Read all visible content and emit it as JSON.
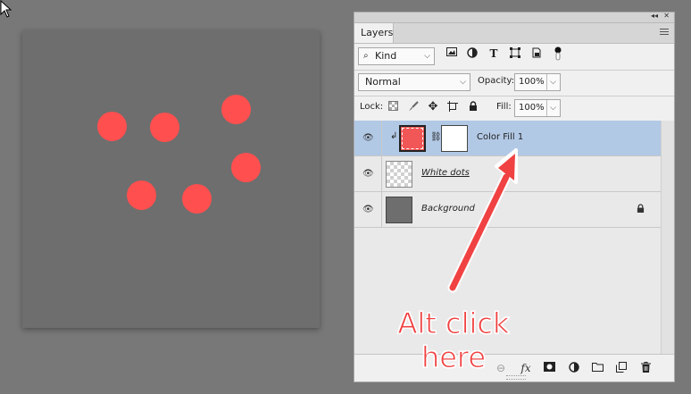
{
  "panel": {
    "title": "Layers",
    "collapse_glyph": "◂◂",
    "close_glyph": "✕"
  },
  "filter": {
    "kind_label": "Kind",
    "icons": [
      "image-filter-icon",
      "adjustment-filter-icon",
      "type-filter-icon",
      "shape-filter-icon",
      "smart-object-filter-icon",
      "filter-toggle-icon"
    ]
  },
  "blend": {
    "mode": "Normal",
    "opacity_label": "Opacity:",
    "opacity_value": "100%"
  },
  "lock": {
    "label": "Lock:",
    "fill_label": "Fill:",
    "fill_value": "100%"
  },
  "layers": [
    {
      "name": "Color Fill 1",
      "selected": true,
      "thumb_color": "#f25757",
      "mask": true
    },
    {
      "name": "White dots",
      "selected": false,
      "thumb": "transparent",
      "underlined": true
    },
    {
      "name": "Background",
      "selected": false,
      "thumb_color": "#6e6e6e",
      "locked": true
    }
  ],
  "bottom_icons": [
    "link-layers-icon",
    "fx-icon",
    "add-mask-icon",
    "new-fill-adjustment-icon",
    "new-group-icon",
    "new-layer-icon",
    "delete-icon"
  ],
  "fx_label": "fx",
  "annotation": {
    "line1": "Alt click",
    "line2": "here",
    "color": "#f04242"
  },
  "colors": {
    "workspace": "#787878",
    "canvas": "#6e6e6e",
    "dot": "#ff4f4f",
    "selection": "#b2c9e6"
  }
}
